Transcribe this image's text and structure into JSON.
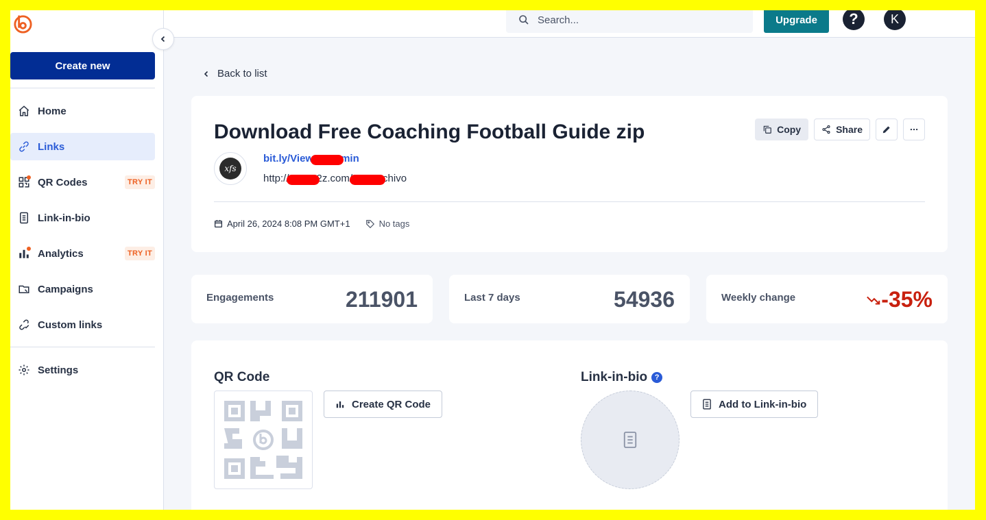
{
  "sidebar": {
    "create_label": "Create new",
    "items": [
      {
        "label": "Home",
        "icon": "home-icon"
      },
      {
        "label": "Links",
        "icon": "link-icon",
        "active": true
      },
      {
        "label": "QR Codes",
        "icon": "qr-code-icon",
        "badge": "TRY IT"
      },
      {
        "label": "Link-in-bio",
        "icon": "link-in-bio-icon"
      },
      {
        "label": "Analytics",
        "icon": "analytics-icon",
        "badge": "TRY IT"
      },
      {
        "label": "Campaigns",
        "icon": "campaigns-icon"
      },
      {
        "label": "Custom links",
        "icon": "custom-links-icon"
      },
      {
        "label": "Settings",
        "icon": "gear-icon"
      }
    ]
  },
  "topbar": {
    "search_placeholder": "Search...",
    "upgrade_label": "Upgrade",
    "help_label": "?",
    "avatar_initial": "K"
  },
  "back_label": "Back to list",
  "link": {
    "title": "Download Free Coaching Football Guide zip",
    "favicon_text": "xfs",
    "short_prefix": "bit.ly/View",
    "short_suffix": "min",
    "long_prefix": "http://",
    "long_middle": "2z.com/",
    "long_suffix": "chivo",
    "date": "April 26, 2024 8:08 PM GMT+1",
    "tags": "No tags"
  },
  "actions": {
    "copy_label": "Copy",
    "share_label": "Share"
  },
  "stats": {
    "engagements_label": "Engagements",
    "engagements_value": "211901",
    "last7_label": "Last 7 days",
    "last7_value": "54936",
    "weekly_label": "Weekly change",
    "weekly_value": "-35%"
  },
  "qr": {
    "title": "QR Code",
    "button_label": "Create QR Code"
  },
  "bio": {
    "title": "Link-in-bio",
    "button_label": "Add to Link-in-bio"
  },
  "colors": {
    "brand_blue": "#022d94",
    "link_blue": "#2a5bd7",
    "upgrade_teal": "#0b7a8a",
    "accent_orange": "#ee6123",
    "negative_red": "#c8200e",
    "frame_yellow": "#ffff00"
  }
}
